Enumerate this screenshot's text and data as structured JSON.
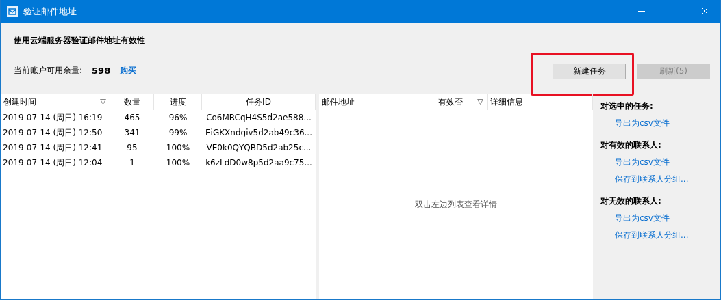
{
  "window": {
    "title": "验证邮件地址"
  },
  "heading": "使用云端服务器验证邮件地址有效性",
  "balance": {
    "label": "当前账户可用余量:",
    "value": "598",
    "link": "购买"
  },
  "buttons": [
    {
      "label": "新建任务",
      "disabled": false,
      "highlighted": true
    },
    {
      "label": "刷新(5)",
      "disabled": true,
      "highlighted": false
    }
  ],
  "tasks": {
    "columns": [
      {
        "label": "创建时间",
        "filter": true
      },
      {
        "label": "数量",
        "filter": false
      },
      {
        "label": "进度",
        "filter": false
      },
      {
        "label": "任务ID",
        "filter": false
      }
    ],
    "rows": [
      [
        "2019-07-14 (周日) 16:19",
        "465",
        "96%",
        "Co6MRCqH4S5d2ae588..."
      ],
      [
        "2019-07-14 (周日) 12:50",
        "341",
        "99%",
        "EiGKXndgiv5d2ab49c36..."
      ],
      [
        "2019-07-14 (周日) 12:41",
        "95",
        "100%",
        "VE0k0QYQBD5d2ab25c..."
      ],
      [
        "2019-07-14 (周日) 12:04",
        "1",
        "100%",
        "k6zLdD0w8p5d2aa9c75..."
      ]
    ]
  },
  "details": {
    "columns": [
      {
        "label": "邮件地址",
        "filter": false
      },
      {
        "label": "有效否",
        "filter": true
      },
      {
        "label": "详细信息",
        "filter": false
      }
    ],
    "empty_message": "双击左边列表查看详情"
  },
  "actions": [
    {
      "title": "对选中的任务:",
      "links": [
        "导出为csv文件"
      ]
    },
    {
      "title": "对有效的联系人:",
      "links": [
        "导出为csv文件",
        "保存到联系人分组..."
      ]
    },
    {
      "title": "对无效的联系人:",
      "links": [
        "导出为csv文件",
        "保存到联系人分组..."
      ]
    }
  ]
}
